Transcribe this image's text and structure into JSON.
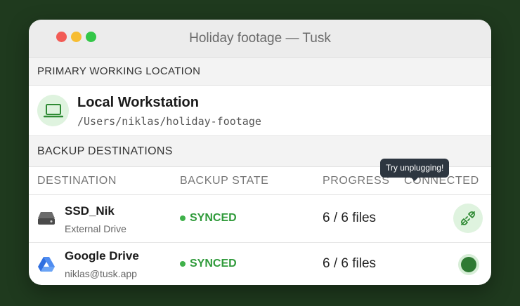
{
  "window": {
    "title": "Holiday footage — Tusk",
    "traffic_colors": [
      "#f25b55",
      "#f7bd32",
      "#33c748"
    ]
  },
  "primary": {
    "section_title": "PRIMARY WORKING LOCATION",
    "name": "Local Workstation",
    "path": "/Users/niklas/holiday-footage",
    "icon": "laptop-icon"
  },
  "backup": {
    "section_title": "BACKUP DESTINATIONS",
    "columns": [
      "DESTINATION",
      "BACKUP STATE",
      "PROGRESS",
      "CONNECTED"
    ],
    "rows": [
      {
        "name": "SSD_Nik",
        "subtitle": "External Drive",
        "icon": "external-drive-icon",
        "state": "SYNCED",
        "progress": "6 / 6 files",
        "connected_control": "unplug-icon"
      },
      {
        "name": "Google Drive",
        "subtitle": "niklas@tusk.app",
        "icon": "google-drive-icon",
        "state": "SYNCED",
        "progress": "6 / 6 files",
        "connected_control": "connected-status-dot"
      }
    ]
  },
  "tooltip": {
    "text": "Try unplugging!"
  },
  "colors": {
    "accent_green": "#2f9a3a",
    "background": "#1f3a1e"
  }
}
